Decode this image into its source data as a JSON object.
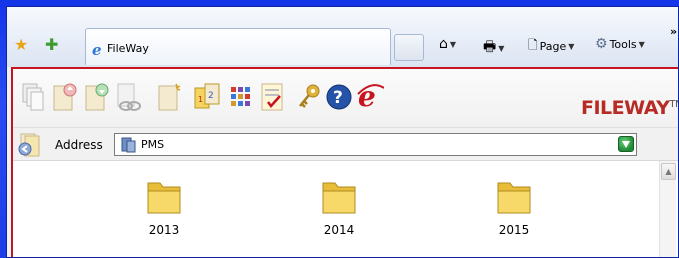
{
  "browser": {
    "favorites_icon": "star-icon",
    "add_favorite_icon": "add-favorite-icon",
    "tab": {
      "title": "FileWay",
      "icon": "ie-icon"
    },
    "commands": {
      "home_icon": "home-icon",
      "print_icon": "printer-icon",
      "page_label": "Page",
      "tools_label": "Tools",
      "overflow": "»"
    }
  },
  "app": {
    "logo_text": "FILEWAY",
    "logo_tm": "TM",
    "address_label": "Address",
    "address_value": "PMS",
    "go_icon": "go-arrow-icon"
  },
  "folders": [
    {
      "label": "2013"
    },
    {
      "label": "2014"
    },
    {
      "label": "2015"
    }
  ],
  "colors": {
    "frame_blue": "#1a3fe0",
    "page_border_red": "#c8141e",
    "folder_yellow": "#f5d35c",
    "logo_red": "#b82a24"
  }
}
